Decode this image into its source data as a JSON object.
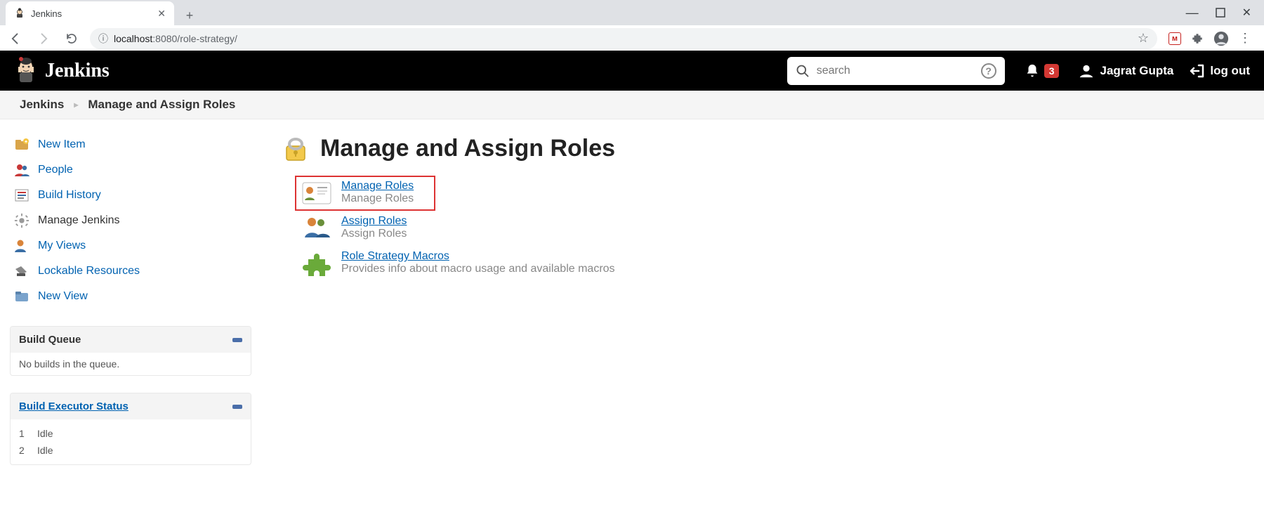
{
  "browser": {
    "tab_title": "Jenkins",
    "url_host": "localhost",
    "url_port_path": ":8080/role-strategy/"
  },
  "header": {
    "app_name": "Jenkins",
    "search_placeholder": "search",
    "notification_count": "3",
    "user_name": "Jagrat Gupta",
    "logout_label": "log out"
  },
  "breadcrumb": {
    "root": "Jenkins",
    "current": "Manage and Assign Roles"
  },
  "sidebar": {
    "items": [
      {
        "label": "New Item"
      },
      {
        "label": "People"
      },
      {
        "label": "Build History"
      },
      {
        "label": "Manage Jenkins"
      },
      {
        "label": "My Views"
      },
      {
        "label": "Lockable Resources"
      },
      {
        "label": "New View"
      }
    ],
    "build_queue": {
      "title": "Build Queue",
      "empty_text": "No builds in the queue."
    },
    "executor": {
      "title": "Build Executor Status",
      "rows": [
        {
          "num": "1",
          "status": "Idle"
        },
        {
          "num": "2",
          "status": "Idle"
        }
      ]
    }
  },
  "main": {
    "title": "Manage and Assign Roles",
    "links": [
      {
        "title": "Manage Roles",
        "desc": "Manage Roles"
      },
      {
        "title": "Assign Roles",
        "desc": "Assign Roles"
      },
      {
        "title": "Role Strategy Macros",
        "desc": "Provides info about macro usage and available macros"
      }
    ]
  }
}
